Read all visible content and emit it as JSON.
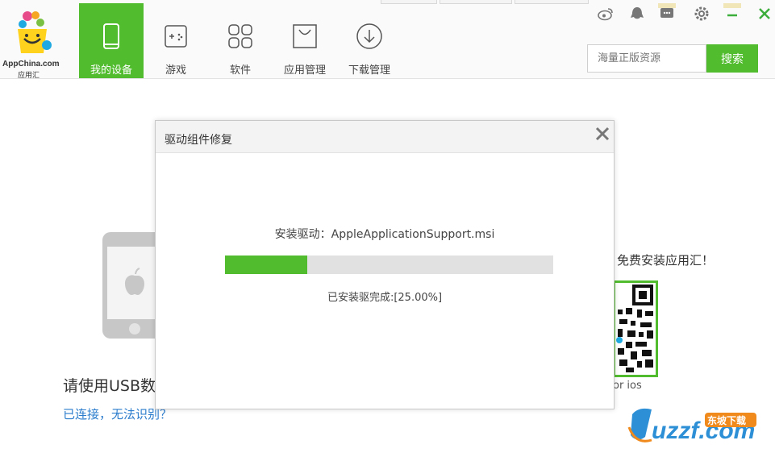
{
  "app": {
    "logo_text": "AppChina.com",
    "logo_sub": "应用汇"
  },
  "nav": {
    "items": [
      {
        "label": "我的设备",
        "icon": "phone-icon",
        "active": true
      },
      {
        "label": "游戏",
        "icon": "gamepad-icon",
        "active": false
      },
      {
        "label": "软件",
        "icon": "apps-grid-icon",
        "active": false
      },
      {
        "label": "应用管理",
        "icon": "shopping-bag-icon",
        "active": false
      },
      {
        "label": "下载管理",
        "icon": "download-icon",
        "active": false
      }
    ]
  },
  "search": {
    "placeholder": "海量正版资源",
    "button_label": "搜索"
  },
  "window_controls": [
    "weibo-icon",
    "qq-icon",
    "feedback-icon",
    "settings-icon",
    "minimize-icon",
    "close-icon"
  ],
  "main": {
    "connect_title": "请使用USB数",
    "connect_link": "已连接，无法识别？",
    "free_install": "免费安装应用汇！",
    "qr_caption": "or ios"
  },
  "dialog": {
    "title": "驱动组件修复",
    "status": "安装驱动：AppleApplicationSupport.msi",
    "progress_text": "已安装驱完成:[25.00%]",
    "progress_fraction": 0.25
  },
  "watermark": {
    "text": "uzzf.com",
    "badge": "东坡下载"
  },
  "colors": {
    "accent": "#52bc2f",
    "link": "#2b7ccc",
    "close_green": "#3cae3c"
  }
}
